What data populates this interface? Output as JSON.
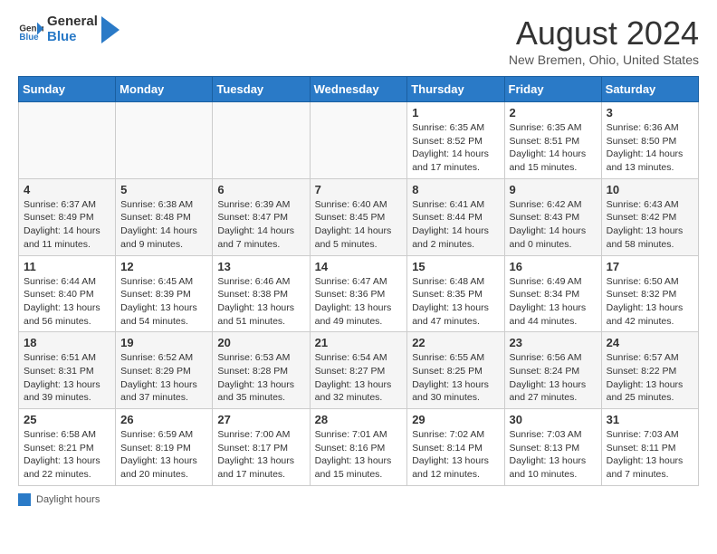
{
  "header": {
    "logo_line1": "General",
    "logo_line2": "Blue",
    "title": "August 2024",
    "subtitle": "New Bremen, Ohio, United States"
  },
  "days_of_week": [
    "Sunday",
    "Monday",
    "Tuesday",
    "Wednesday",
    "Thursday",
    "Friday",
    "Saturday"
  ],
  "weeks": [
    [
      {
        "day": "",
        "info": ""
      },
      {
        "day": "",
        "info": ""
      },
      {
        "day": "",
        "info": ""
      },
      {
        "day": "",
        "info": ""
      },
      {
        "day": "1",
        "info": "Sunrise: 6:35 AM\nSunset: 8:52 PM\nDaylight: 14 hours and 17 minutes."
      },
      {
        "day": "2",
        "info": "Sunrise: 6:35 AM\nSunset: 8:51 PM\nDaylight: 14 hours and 15 minutes."
      },
      {
        "day": "3",
        "info": "Sunrise: 6:36 AM\nSunset: 8:50 PM\nDaylight: 14 hours and 13 minutes."
      }
    ],
    [
      {
        "day": "4",
        "info": "Sunrise: 6:37 AM\nSunset: 8:49 PM\nDaylight: 14 hours and 11 minutes."
      },
      {
        "day": "5",
        "info": "Sunrise: 6:38 AM\nSunset: 8:48 PM\nDaylight: 14 hours and 9 minutes."
      },
      {
        "day": "6",
        "info": "Sunrise: 6:39 AM\nSunset: 8:47 PM\nDaylight: 14 hours and 7 minutes."
      },
      {
        "day": "7",
        "info": "Sunrise: 6:40 AM\nSunset: 8:45 PM\nDaylight: 14 hours and 5 minutes."
      },
      {
        "day": "8",
        "info": "Sunrise: 6:41 AM\nSunset: 8:44 PM\nDaylight: 14 hours and 2 minutes."
      },
      {
        "day": "9",
        "info": "Sunrise: 6:42 AM\nSunset: 8:43 PM\nDaylight: 14 hours and 0 minutes."
      },
      {
        "day": "10",
        "info": "Sunrise: 6:43 AM\nSunset: 8:42 PM\nDaylight: 13 hours and 58 minutes."
      }
    ],
    [
      {
        "day": "11",
        "info": "Sunrise: 6:44 AM\nSunset: 8:40 PM\nDaylight: 13 hours and 56 minutes."
      },
      {
        "day": "12",
        "info": "Sunrise: 6:45 AM\nSunset: 8:39 PM\nDaylight: 13 hours and 54 minutes."
      },
      {
        "day": "13",
        "info": "Sunrise: 6:46 AM\nSunset: 8:38 PM\nDaylight: 13 hours and 51 minutes."
      },
      {
        "day": "14",
        "info": "Sunrise: 6:47 AM\nSunset: 8:36 PM\nDaylight: 13 hours and 49 minutes."
      },
      {
        "day": "15",
        "info": "Sunrise: 6:48 AM\nSunset: 8:35 PM\nDaylight: 13 hours and 47 minutes."
      },
      {
        "day": "16",
        "info": "Sunrise: 6:49 AM\nSunset: 8:34 PM\nDaylight: 13 hours and 44 minutes."
      },
      {
        "day": "17",
        "info": "Sunrise: 6:50 AM\nSunset: 8:32 PM\nDaylight: 13 hours and 42 minutes."
      }
    ],
    [
      {
        "day": "18",
        "info": "Sunrise: 6:51 AM\nSunset: 8:31 PM\nDaylight: 13 hours and 39 minutes."
      },
      {
        "day": "19",
        "info": "Sunrise: 6:52 AM\nSunset: 8:29 PM\nDaylight: 13 hours and 37 minutes."
      },
      {
        "day": "20",
        "info": "Sunrise: 6:53 AM\nSunset: 8:28 PM\nDaylight: 13 hours and 35 minutes."
      },
      {
        "day": "21",
        "info": "Sunrise: 6:54 AM\nSunset: 8:27 PM\nDaylight: 13 hours and 32 minutes."
      },
      {
        "day": "22",
        "info": "Sunrise: 6:55 AM\nSunset: 8:25 PM\nDaylight: 13 hours and 30 minutes."
      },
      {
        "day": "23",
        "info": "Sunrise: 6:56 AM\nSunset: 8:24 PM\nDaylight: 13 hours and 27 minutes."
      },
      {
        "day": "24",
        "info": "Sunrise: 6:57 AM\nSunset: 8:22 PM\nDaylight: 13 hours and 25 minutes."
      }
    ],
    [
      {
        "day": "25",
        "info": "Sunrise: 6:58 AM\nSunset: 8:21 PM\nDaylight: 13 hours and 22 minutes."
      },
      {
        "day": "26",
        "info": "Sunrise: 6:59 AM\nSunset: 8:19 PM\nDaylight: 13 hours and 20 minutes."
      },
      {
        "day": "27",
        "info": "Sunrise: 7:00 AM\nSunset: 8:17 PM\nDaylight: 13 hours and 17 minutes."
      },
      {
        "day": "28",
        "info": "Sunrise: 7:01 AM\nSunset: 8:16 PM\nDaylight: 13 hours and 15 minutes."
      },
      {
        "day": "29",
        "info": "Sunrise: 7:02 AM\nSunset: 8:14 PM\nDaylight: 13 hours and 12 minutes."
      },
      {
        "day": "30",
        "info": "Sunrise: 7:03 AM\nSunset: 8:13 PM\nDaylight: 13 hours and 10 minutes."
      },
      {
        "day": "31",
        "info": "Sunrise: 7:03 AM\nSunset: 8:11 PM\nDaylight: 13 hours and 7 minutes."
      }
    ]
  ],
  "legend": {
    "label": "Daylight hours"
  }
}
